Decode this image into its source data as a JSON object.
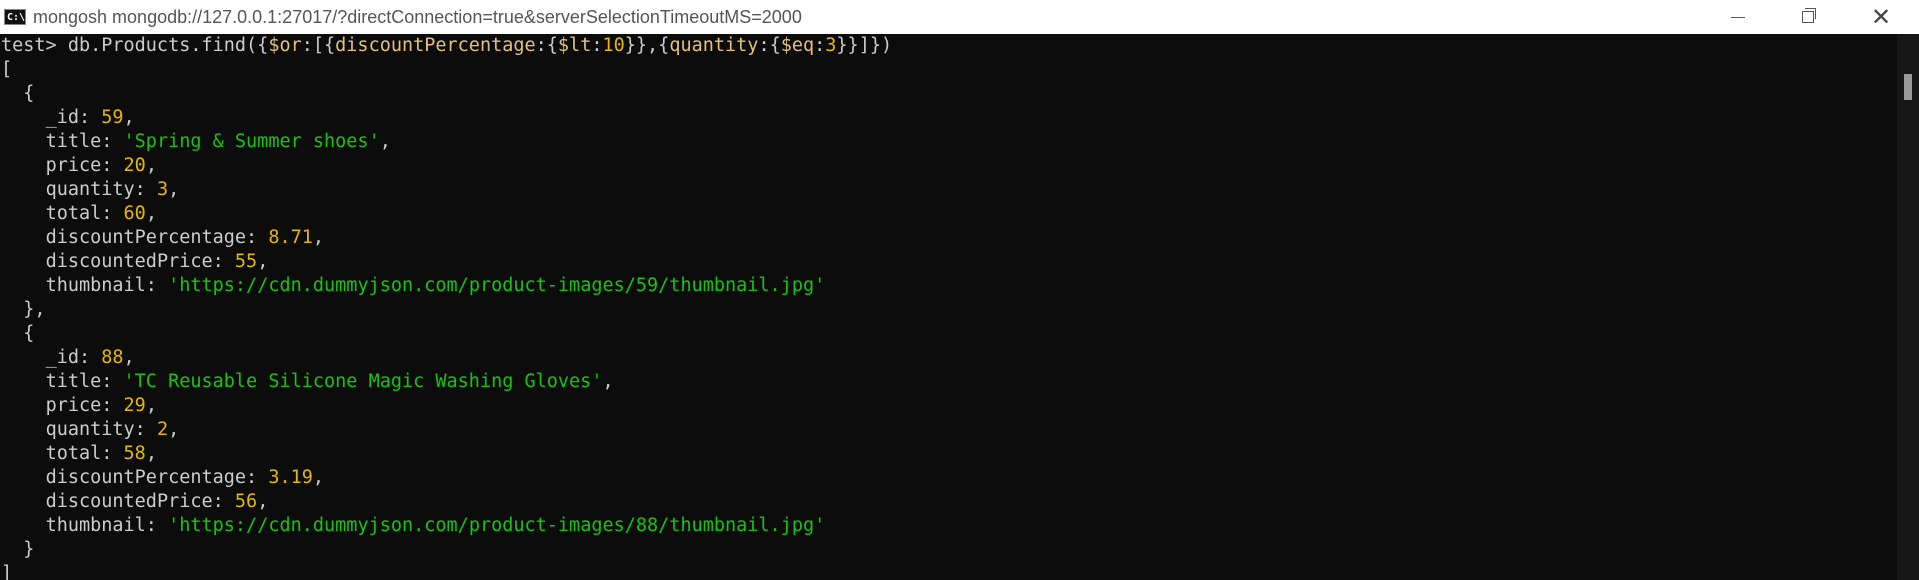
{
  "window": {
    "title": "mongosh mongodb://127.0.0.1:27017/?directConnection=true&serverSelectionTimeoutMS=2000",
    "icon_text": "C:\\.",
    "icon": "cmd-icon",
    "controls": {
      "minimize": "minimize-icon",
      "maximize": "restore-icon",
      "close": "✕"
    }
  },
  "colors": {
    "background": "#0c0c0c",
    "text": "#cccccc",
    "number": "#e5b800",
    "string": "#16c60c",
    "operator": "#e5c07b"
  },
  "terminal": {
    "prompt": "test> ",
    "command_parts": [
      "db.Products.find({",
      "$or",
      ":[{",
      "discountPercentage",
      ":{",
      "$lt",
      ":",
      "10",
      "}},{",
      "quantity",
      ":{",
      "$eq",
      ":",
      "3",
      "}}]})"
    ],
    "open_bracket": "[",
    "documents": [
      {
        "_id": "59",
        "title": "'Spring & Summer shoes'",
        "price": "20",
        "quantity": "3",
        "total": "60",
        "discountPercentage": "8.71",
        "discountedPrice": "55",
        "thumbnail": "'https://cdn.dummyjson.com/product-images/59/thumbnail.jpg'"
      },
      {
        "_id": "88",
        "title": "'TC Reusable Silicone Magic Washing Gloves'",
        "price": "29",
        "quantity": "2",
        "total": "58",
        "discountPercentage": "3.19",
        "discountedPrice": "56",
        "thumbnail": "'https://cdn.dummyjson.com/product-images/88/thumbnail.jpg'"
      }
    ],
    "keys": {
      "id": "_id: ",
      "title": "title: ",
      "price": "price: ",
      "quantity": "quantity: ",
      "total": "total: ",
      "discountPercentage": "discountPercentage: ",
      "discountedPrice": "discountedPrice: ",
      "thumbnail": "thumbnail: "
    },
    "punct": {
      "comma": ",",
      "open_brace": "  {",
      "close_brace_comma": "  },",
      "close_brace": "  }",
      "close_bracket": "]"
    }
  }
}
